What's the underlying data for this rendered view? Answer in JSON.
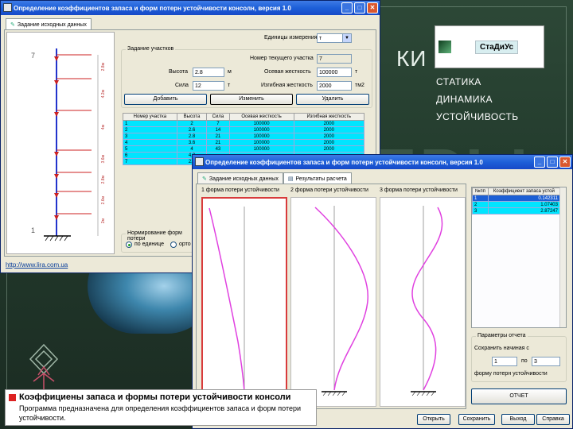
{
  "background": {
    "big_word_1": "КИ",
    "big_word_2": "ЕРЫ",
    "logo_name": "СтаДиУс",
    "menu": [
      "СТАТИКА",
      "ДИНАМИКА",
      "УСТОЙЧИВОСТЬ"
    ]
  },
  "win1": {
    "title": "Определение коэффициентов запаса и форм потерн устойчивости консолн, версия 1.0",
    "tab": "Задание исходных данных",
    "units_label": "Единицы измерения",
    "units_value": "т",
    "sections_group": "Задание участков",
    "current_label": "Номер текущего участка",
    "current_value": "7",
    "height_label": "Высота",
    "height_value": "2.8",
    "height_unit": "м",
    "axial_label": "Осевая жесткость",
    "axial_value": "100000",
    "axial_unit": "т",
    "force_label": "Сила",
    "force_value": "12",
    "force_unit": "т",
    "bend_label": "Изгибная жесткость",
    "bend_value": "2000",
    "bend_unit": "тм2",
    "add_btn": "Добавить",
    "edit_btn": "Изменить",
    "del_btn": "Удалить",
    "table_headers": [
      "Номер участка",
      "Высота",
      "Сила",
      "Осевая жесткость",
      "Изгибная жесткость"
    ],
    "table_rows": [
      [
        "1",
        "2",
        "7",
        "100000",
        "2000"
      ],
      [
        "2",
        "2.6",
        "14",
        "100000",
        "2000"
      ],
      [
        "3",
        "2.8",
        "21",
        "100000",
        "2000"
      ],
      [
        "4",
        "3.6",
        "21",
        "100000",
        "2000"
      ],
      [
        "5",
        "4",
        "43",
        "100000",
        "2000"
      ],
      [
        "6",
        "4.2",
        "",
        "",
        ""
      ],
      [
        "7",
        "2.8",
        "",
        "",
        ""
      ]
    ],
    "norm_group": "Нормирование форм потери",
    "norm_opt1": "по единице",
    "norm_opt2": "орто",
    "beam_top": "7",
    "beam_bottom": "1",
    "dims": [
      "2.8м",
      "4.2м",
      "4м",
      "3.6м",
      "2.8м",
      "2.6м",
      "2м"
    ],
    "url": "http://www.lira.com.ua"
  },
  "win2": {
    "title": "Определение коэффициентов запаса и форм потерн устойчивости консолн, версия 1.0",
    "tab1": "Задание исходных данных",
    "tab2": "Результаты расчета",
    "plot_titles": [
      "1 форма потери устойчивости",
      "2 форма потери устойчивости",
      "3 форма потери устойчивости"
    ],
    "coef_headers": [
      "№пп",
      "Коэффициент запаса устой"
    ],
    "coef_rows": [
      [
        "1",
        "0.142311"
      ],
      [
        "2",
        "1.07403"
      ],
      [
        "3",
        "2.87247"
      ]
    ],
    "params_group": "Параметры отчета",
    "save_from": "Сохранить начиная с",
    "from_value": "1",
    "to_label": "по",
    "to_value": "3",
    "forms_label": "форму потерн устойчивости",
    "report_btn": "ОТЧЕТ",
    "open_btn": "Открыть",
    "save_btn": "Сохранить",
    "exit_btn": "Выход",
    "help_btn": "Справка"
  },
  "banner": {
    "heading": "Коэффициены запаса и формы потери устойчивости консоли",
    "body": "Программа предназначена для определения коэффициентов запаса и форм потери устойчивости."
  }
}
